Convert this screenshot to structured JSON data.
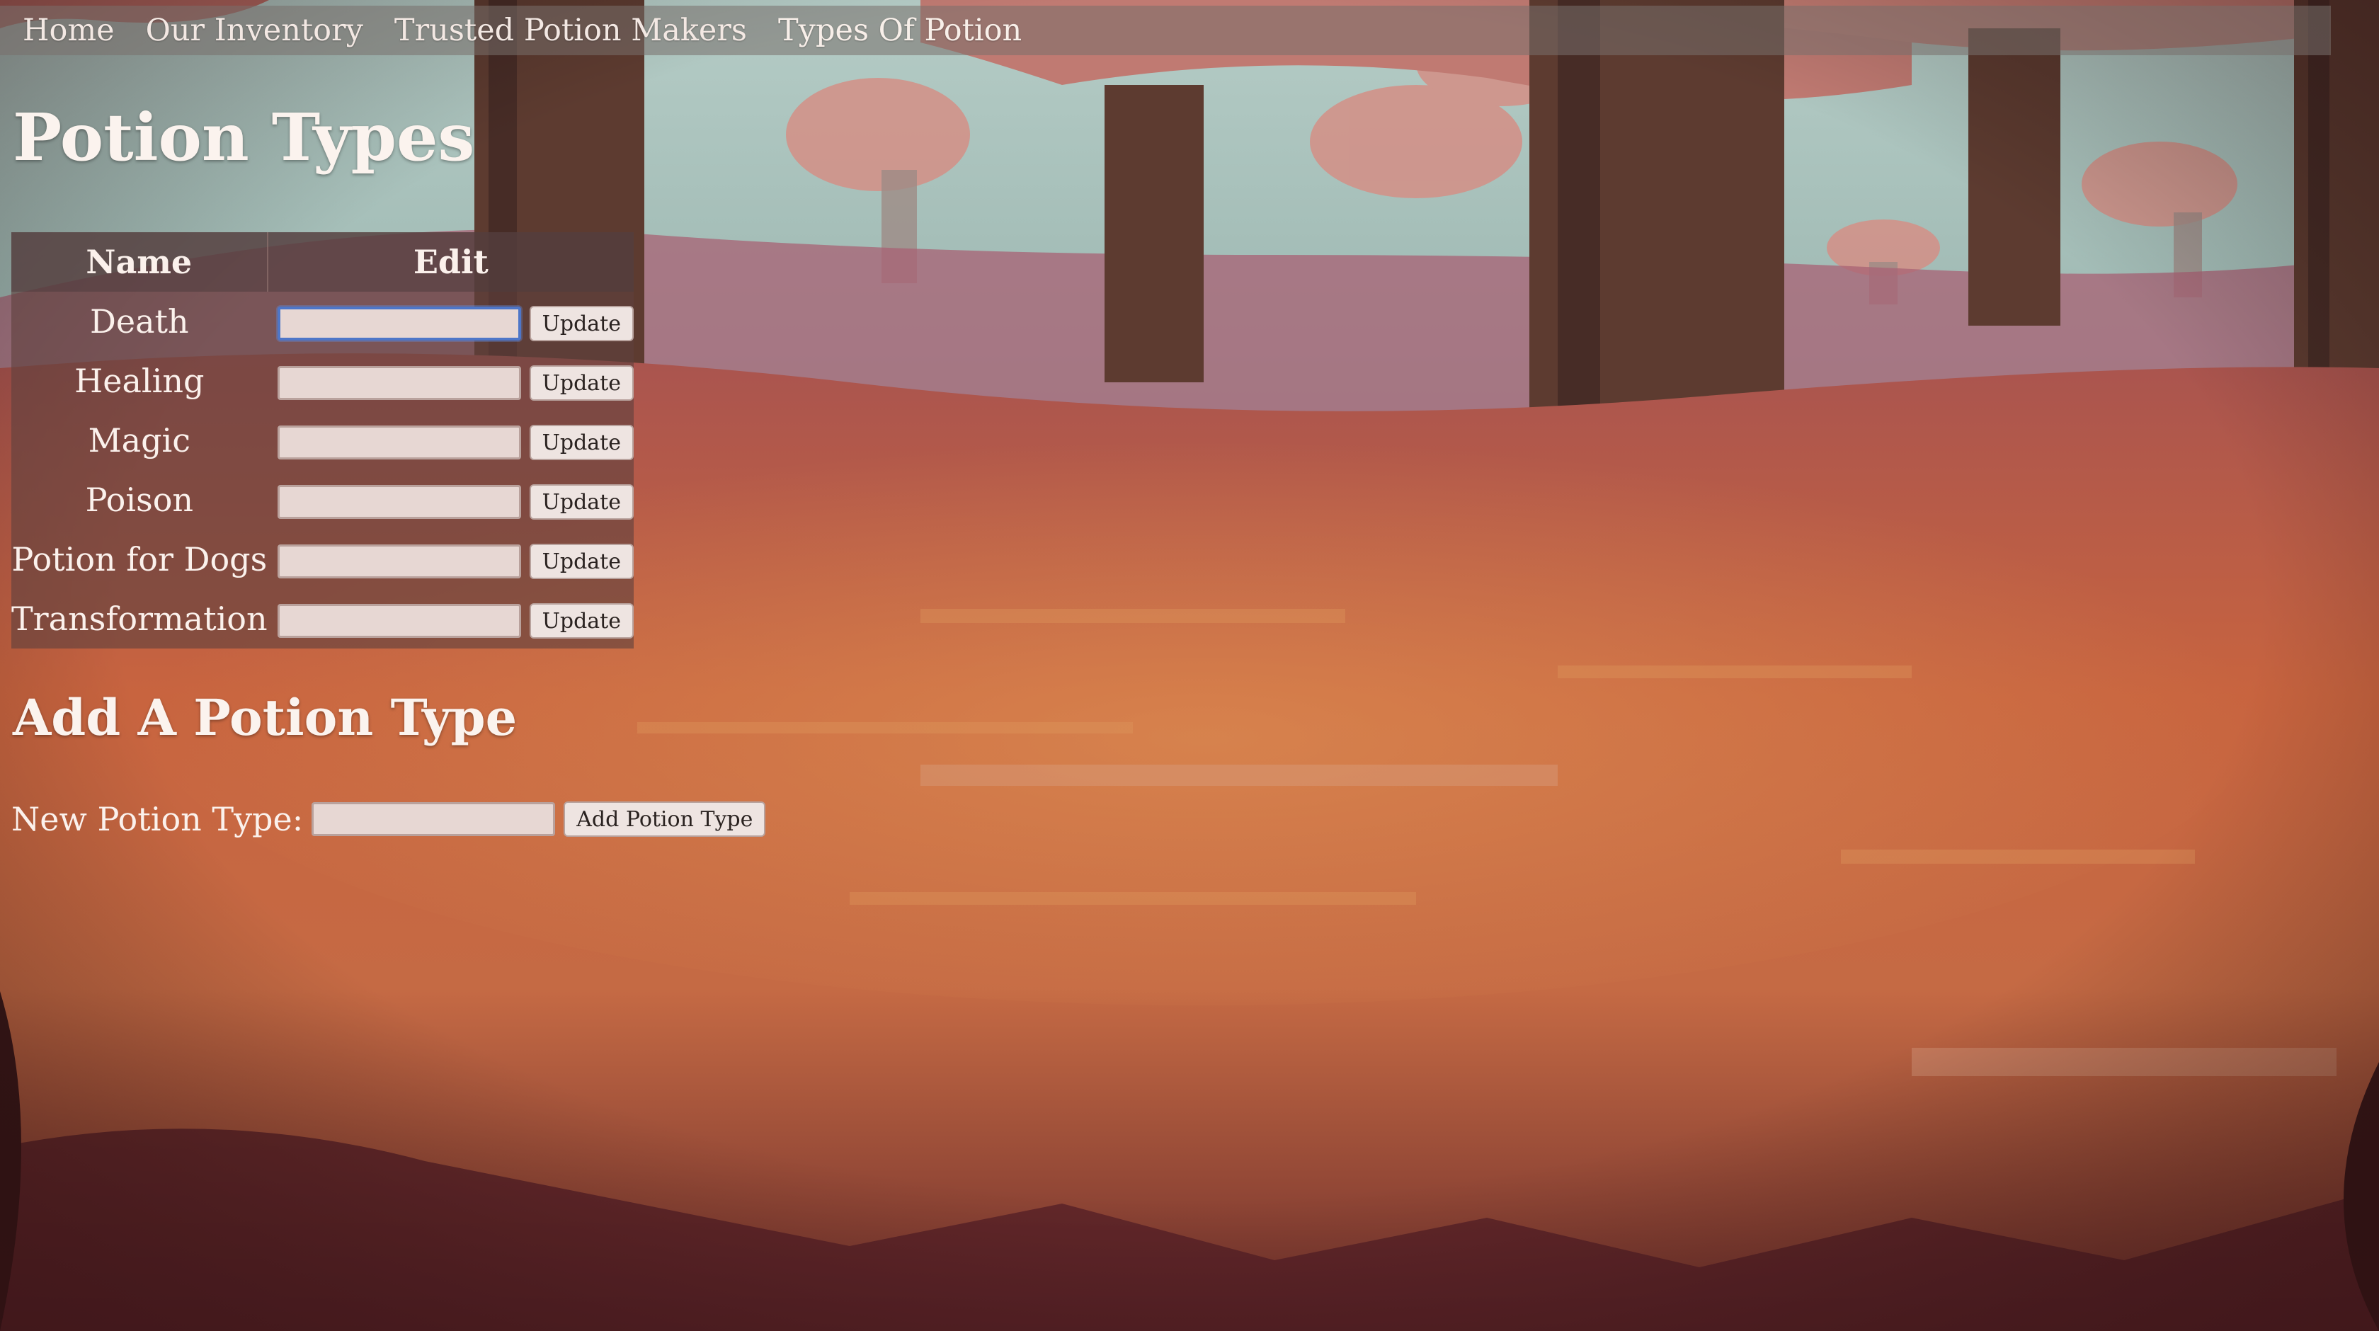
{
  "nav": {
    "items": [
      {
        "label": "Home"
      },
      {
        "label": "Our Inventory"
      },
      {
        "label": "Trusted Potion Makers"
      },
      {
        "label": "Types Of Potion"
      }
    ]
  },
  "page": {
    "title": "Potion Types"
  },
  "table": {
    "headers": {
      "name": "Name",
      "edit": "Edit"
    },
    "rows": [
      {
        "name": "Death",
        "input_value": "",
        "button_label": "Update"
      },
      {
        "name": "Healing",
        "input_value": "",
        "button_label": "Update"
      },
      {
        "name": "Magic",
        "input_value": "",
        "button_label": "Update"
      },
      {
        "name": "Poison",
        "input_value": "",
        "button_label": "Update"
      },
      {
        "name": "Potion for Dogs",
        "input_value": "",
        "button_label": "Update"
      },
      {
        "name": "Transformation",
        "input_value": "",
        "button_label": "Update"
      }
    ]
  },
  "add_section": {
    "title": "Add A Potion Type",
    "field_label": "New Potion Type:",
    "input_value": "",
    "button_label": "Add Potion Type"
  },
  "colors": {
    "sky": "#a9c4bd",
    "tree_trunk": "#5a3a2e",
    "canopy": "#c47c72",
    "meadow": "#c8623f",
    "focus_ring": "#4e76c8"
  }
}
